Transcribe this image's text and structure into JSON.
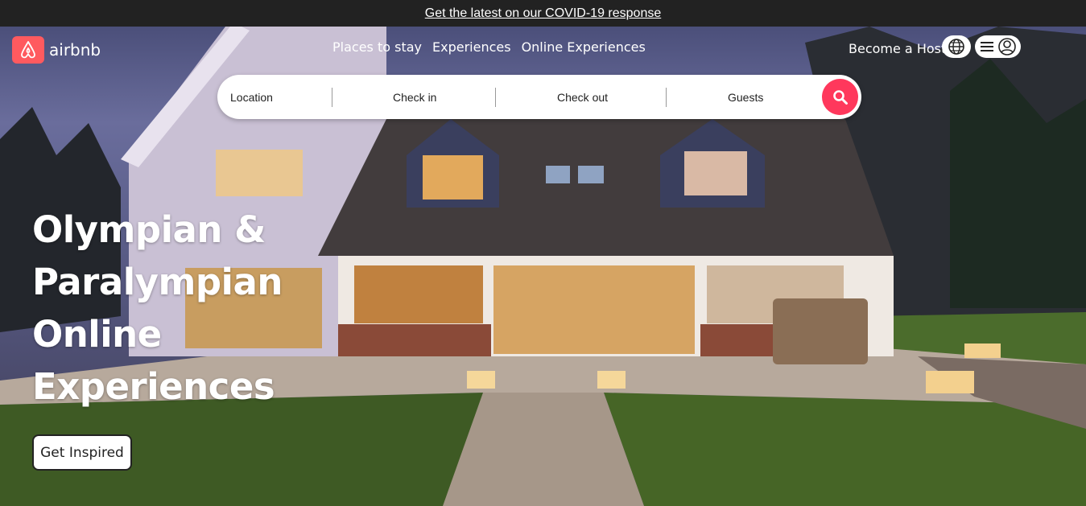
{
  "banner": {
    "link_text": "Get the latest on our COVID-19 response"
  },
  "header": {
    "brand": "airbnb",
    "nav": [
      "Places to stay",
      "Experiences",
      "Online Experiences"
    ],
    "host_link": "Become a Host",
    "icons": {
      "logo": "airbnb-logo-icon",
      "language": "globe-icon",
      "menu": "hamburger-icon",
      "profile": "user-circle-icon"
    }
  },
  "search": {
    "location": "Location",
    "check_in": "Check in",
    "check_out": "Check out",
    "guests": "Guests",
    "button_icon": "search-icon"
  },
  "hero": {
    "headline_lines": [
      "Olympian &",
      "Paralympian",
      "Online",
      "Experiences"
    ],
    "cta_label": "Get Inspired"
  },
  "colors": {
    "brand": "#ff5a5f",
    "search_accent": "#ff385c",
    "banner_bg": "#222222"
  }
}
